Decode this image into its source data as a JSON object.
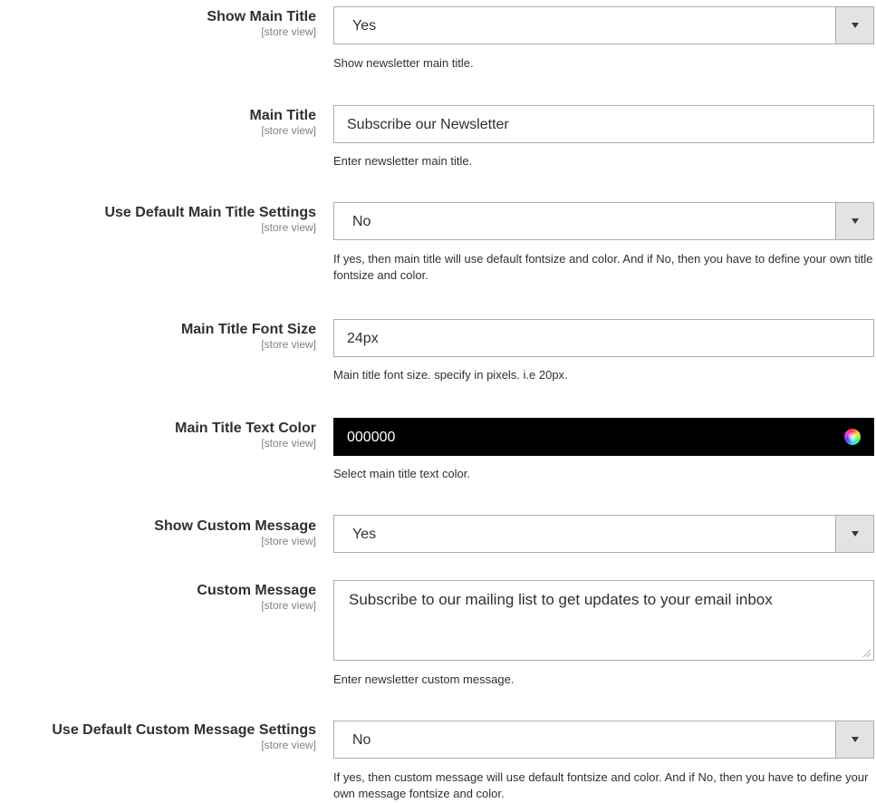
{
  "fields": [
    {
      "label": "Show Main Title",
      "scope": "[store view]",
      "value": "Yes",
      "note": "Show newsletter main title."
    },
    {
      "label": "Main Title",
      "scope": "[store view]",
      "value": "Subscribe our Newsletter",
      "note": "Enter newsletter main title."
    },
    {
      "label": "Use Default Main Title Settings",
      "scope": "[store view]",
      "value": "No",
      "note": "If yes, then main title will use default fontsize and color. And if No, then you have to define your own title fontsize and color."
    },
    {
      "label": "Main Title Font Size",
      "scope": "[store view]",
      "value": "24px",
      "note": "Main title font size. specify in pixels. i.e 20px."
    },
    {
      "label": "Main Title Text Color",
      "scope": "[store view]",
      "value": "000000",
      "note": "Select main title text color.",
      "swatch_color": "#000000"
    },
    {
      "label": "Show Custom Message",
      "scope": "[store view]",
      "value": "Yes"
    },
    {
      "label": "Custom Message",
      "scope": "[store view]",
      "value": "Subscribe to our mailing list to get updates to your email inbox",
      "note": "Enter newsletter custom message."
    },
    {
      "label": "Use Default Custom Message Settings",
      "scope": "[store view]",
      "value": "No",
      "note": "If yes, then custom message will use default fontsize and color. And if No, then you have to define your own message fontsize and color."
    }
  ],
  "icons": {
    "dropdown": "chevron-down-icon",
    "color_picker": "color-wheel-icon",
    "resize": "resize-grip-icon"
  }
}
